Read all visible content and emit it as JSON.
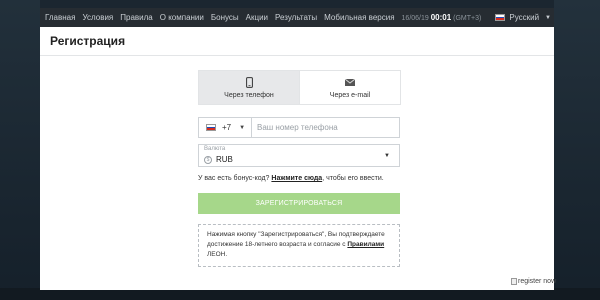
{
  "nav": {
    "items": [
      "Главная",
      "Условия",
      "Правила",
      "О компании",
      "Бонусы",
      "Акции",
      "Результаты",
      "Мобильная версия"
    ],
    "date": "16/06/19",
    "time": "00:01",
    "timezone": "(GMT+3)",
    "language": "Русский"
  },
  "page": {
    "title": "Регистрация"
  },
  "tabs": [
    {
      "label": "Через телефон",
      "icon": "phone-icon",
      "active": true
    },
    {
      "label": "Через e-mail",
      "icon": "mail-icon",
      "active": false
    }
  ],
  "phone": {
    "country_code": "+7",
    "placeholder": "Ваш номер телефона",
    "value": ""
  },
  "currency": {
    "label": "Валюта",
    "value": "RUB"
  },
  "bonus": {
    "prefix": "У вас есть бонус-код?",
    "link": "Нажмите сюда",
    "suffix": ", чтобы его ввести."
  },
  "register": {
    "button_label": "ЗАРЕГИСТРИРОВАТЬСЯ",
    "button_color": "#a6d78a"
  },
  "notice": {
    "text_before": "Нажимая кнопку \"Зарегистрироваться\", Вы подтверждаете достижение 18-летнего возраста и согласие с ",
    "link": "Правилами",
    "text_after": " ЛЕОН."
  },
  "footer_image": {
    "alt": "register now"
  },
  "colors": {
    "nav_bg": "#262c32",
    "accent_green": "#a6d78a",
    "page_bg": "#1b2630"
  }
}
